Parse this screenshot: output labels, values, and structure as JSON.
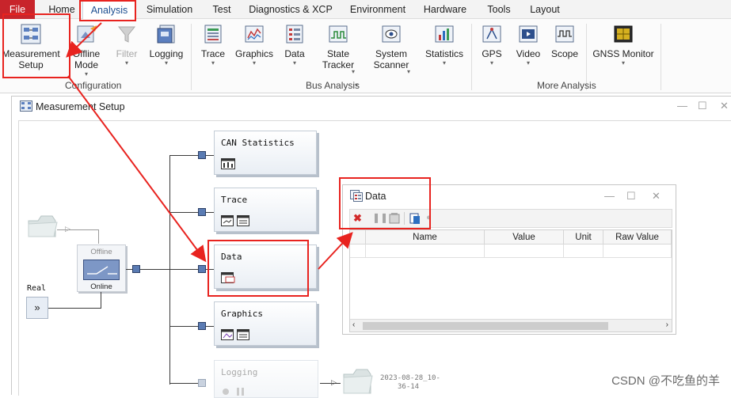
{
  "menu": {
    "file": "File",
    "items": [
      "Home",
      "Analysis",
      "Simulation",
      "Test",
      "Diagnostics & XCP",
      "Environment",
      "Hardware",
      "Tools",
      "Layout"
    ]
  },
  "ribbon": {
    "configuration": {
      "label": "Configuration",
      "buttons": [
        {
          "line1": "Measurement",
          "line2": "Setup"
        },
        {
          "line1": "Offline",
          "line2": "Mode"
        },
        {
          "line1": "Filter",
          "line2": ""
        },
        {
          "line1": "Logging",
          "line2": ""
        }
      ]
    },
    "bus_analysis": {
      "label": "Bus Analysis",
      "buttons": [
        {
          "line1": "Trace",
          "line2": ""
        },
        {
          "line1": "Graphics",
          "line2": ""
        },
        {
          "line1": "Data",
          "line2": ""
        },
        {
          "line1": "State",
          "line2": "Tracker"
        },
        {
          "line1": "System",
          "line2": "Scanner"
        },
        {
          "line1": "Statistics",
          "line2": ""
        }
      ]
    },
    "more_analysis": {
      "label": "More Analysis",
      "buttons": [
        {
          "line1": "GPS",
          "line2": ""
        },
        {
          "line1": "Video",
          "line2": ""
        },
        {
          "line1": "Scope",
          "line2": ""
        },
        {
          "line1": "GNSS Monitor",
          "line2": ""
        }
      ]
    }
  },
  "measurement_window": {
    "title": "Measurement Setup",
    "source": {
      "offline": "Offline",
      "online": "Online",
      "real": "Real",
      "real_button": "»"
    },
    "blocks": {
      "can_statistics": "CAN Statistics",
      "trace": "Trace",
      "data": "Data",
      "graphics": "Graphics",
      "logging": "Logging"
    },
    "log_file": {
      "line1": "2023-08-28_10-",
      "line2": "36-14"
    }
  },
  "data_window": {
    "title": "Data",
    "columns": [
      "Name",
      "Value",
      "Unit",
      "Raw Value"
    ]
  },
  "watermark": "CSDN @不吃鱼的羊",
  "colors": {
    "annotation_red": "#e8231f",
    "file_menu": "#c8242b",
    "node_blue": "#5a7bb3"
  }
}
